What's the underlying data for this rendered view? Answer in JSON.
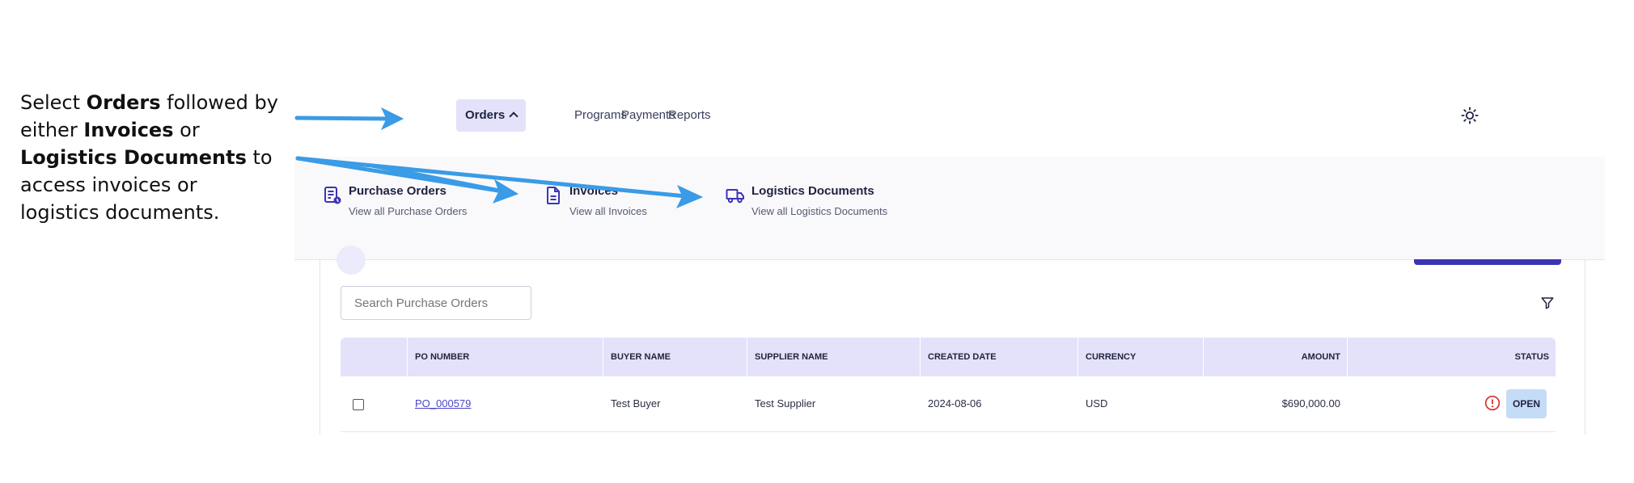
{
  "instruction": {
    "p1": "Select ",
    "b1": "Orders",
    "p2": " followed by either ",
    "b2": "Invoices",
    "p3": " or ",
    "b3": "Logistics Documents",
    "p4": " to access invoices or logistics documents."
  },
  "nav": {
    "items": [
      {
        "label": "Orders"
      },
      {
        "label": "Programs"
      },
      {
        "label": "Payments"
      },
      {
        "label": "Reports"
      }
    ],
    "theme_icon": "sun-icon"
  },
  "menu": {
    "items": [
      {
        "title": "Purchase Orders",
        "subtitle": "View all Purchase Orders",
        "icon": "document-list-icon"
      },
      {
        "title": "Invoices",
        "subtitle": "View all Invoices",
        "icon": "document-icon"
      },
      {
        "title": "Logistics Documents",
        "subtitle": "View all Logistics Documents",
        "icon": "truck-icon"
      }
    ]
  },
  "search": {
    "placeholder": "Search Purchase Orders"
  },
  "table": {
    "headers": [
      "PO NUMBER",
      "BUYER NAME",
      "SUPPLIER NAME",
      "CREATED DATE",
      "CURRENCY",
      "AMOUNT",
      "STATUS"
    ],
    "rows": [
      {
        "po_number": "PO_000579",
        "buyer": "Test Buyer",
        "supplier": "Test Supplier",
        "created": "2024-08-06",
        "currency": "USD",
        "amount": "$690,000.00",
        "status": "OPEN"
      }
    ]
  },
  "colors": {
    "accent": "#3c34b5",
    "arrow": "#3a9be6",
    "header_bg": "#e3e2fa",
    "badge_bg": "#c5dcf7",
    "warn": "#d9322b"
  }
}
